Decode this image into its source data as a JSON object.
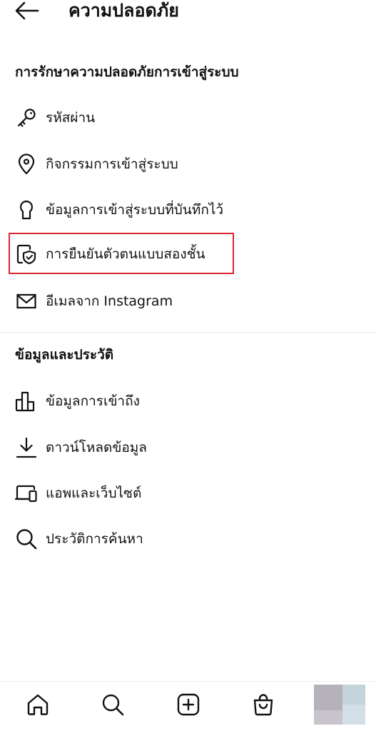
{
  "header": {
    "title": "ความปลอดภัย",
    "back_icon": "arrow-left-icon"
  },
  "sections": [
    {
      "title": "การรักษาความปลอดภัยการเข้าสู่ระบบ",
      "items": [
        {
          "label": "รหัสผ่าน",
          "icon": "key-icon"
        },
        {
          "label": "กิจกรรมการเข้าสู่ระบบ",
          "icon": "location-pin-icon"
        },
        {
          "label": "ข้อมูลการเข้าสู่ระบบที่บันทึกไว้",
          "icon": "keyhole-icon"
        },
        {
          "label": "การยืนยันตัวตนแบบสองชั้น",
          "icon": "shield-phone-icon",
          "highlighted": true
        },
        {
          "label": "อีเมลจาก Instagram",
          "icon": "mail-icon"
        }
      ]
    },
    {
      "title": "ข้อมูลและประวัติ",
      "items": [
        {
          "label": "ข้อมูลการเข้าถึง",
          "icon": "bar-chart-icon"
        },
        {
          "label": "ดาวน์โหลดข้อมูล",
          "icon": "download-icon"
        },
        {
          "label": "แอพและเว็บไซต์",
          "icon": "devices-icon"
        },
        {
          "label": "ประวัติการค้นหา",
          "icon": "search-icon"
        }
      ]
    }
  ],
  "bottom_nav": {
    "items": [
      "home-icon",
      "search-icon",
      "create-icon",
      "shop-icon",
      "profile-avatar"
    ]
  },
  "colors": {
    "highlight": "#d9262c",
    "text": "#111111",
    "divider": "#e6e6e6"
  }
}
